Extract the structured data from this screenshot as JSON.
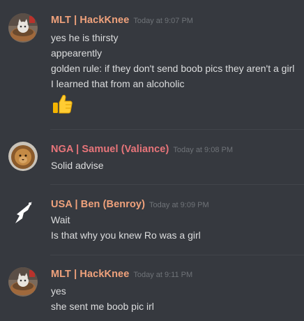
{
  "messages": [
    {
      "username": "MLT | HackKnee",
      "name_color": "#f0a27c",
      "timestamp": "Today at 9:07 PM",
      "avatar": "cat-in-basket-avatar",
      "lines": [
        "yes he is thirsty",
        "appearently",
        "golden rule: if they don't send boob pics they aren't a girl",
        "I learned that from an alcoholic"
      ],
      "emoji": "thumbs-up-emoji"
    },
    {
      "username": "NGA | Samuel (Valiance)",
      "name_color": "#e8757a",
      "timestamp": "Today at 9:08 PM",
      "avatar": "lion-avatar",
      "lines": [
        "Solid advise"
      ]
    },
    {
      "username": "USA | Ben (Benroy)",
      "name_color": "#f0a27c",
      "timestamp": "Today at 9:09 PM",
      "avatar": "white-bird-avatar",
      "lines": [
        "Wait",
        "Is that why you knew Ro was a girl"
      ]
    },
    {
      "username": "MLT | HackKnee",
      "name_color": "#f0a27c",
      "timestamp": "Today at 9:11 PM",
      "avatar": "cat-in-basket-avatar",
      "lines": [
        "yes",
        "she sent me boob pic irl"
      ]
    }
  ]
}
